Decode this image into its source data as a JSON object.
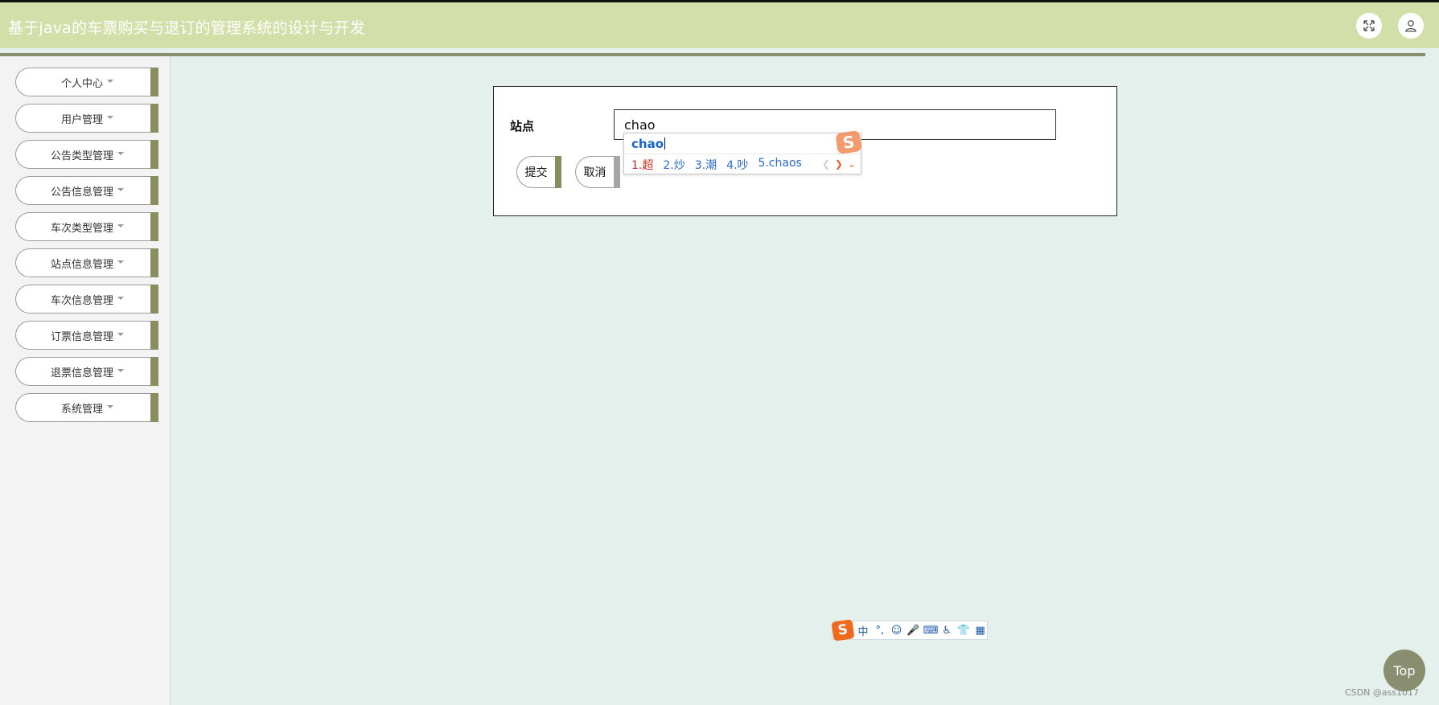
{
  "header": {
    "title": "基于java的车票购买与退订的管理系统的设计与开发",
    "fullscreen_icon": "fullscreen-icon",
    "user_icon": "user-icon"
  },
  "sidebar": {
    "items": [
      {
        "label": "个人中心"
      },
      {
        "label": "用户管理"
      },
      {
        "label": "公告类型管理"
      },
      {
        "label": "公告信息管理"
      },
      {
        "label": "车次类型管理"
      },
      {
        "label": "站点信息管理"
      },
      {
        "label": "车次信息管理"
      },
      {
        "label": "订票信息管理"
      },
      {
        "label": "退票信息管理"
      },
      {
        "label": "系统管理"
      }
    ]
  },
  "form": {
    "station_label": "站点",
    "station_value": "chao",
    "submit_label": "提交",
    "cancel_label": "取消"
  },
  "ime": {
    "pinyin": "chao",
    "candidates": [
      "1.超",
      "2.炒",
      "3.潮",
      "4.吵",
      "5.chaos"
    ],
    "toolbar": [
      "中",
      "°,",
      "☺",
      "🎤",
      "⌨",
      "♿",
      "👕",
      "▦"
    ]
  },
  "top_button": "Top",
  "watermark": "CSDN @ass1017",
  "colors": {
    "header_bg": "#d3dfa9",
    "accent": "#8a8e5e",
    "content_bg": "#e4f0eb",
    "sidebar_bg": "#f3f3f3"
  }
}
